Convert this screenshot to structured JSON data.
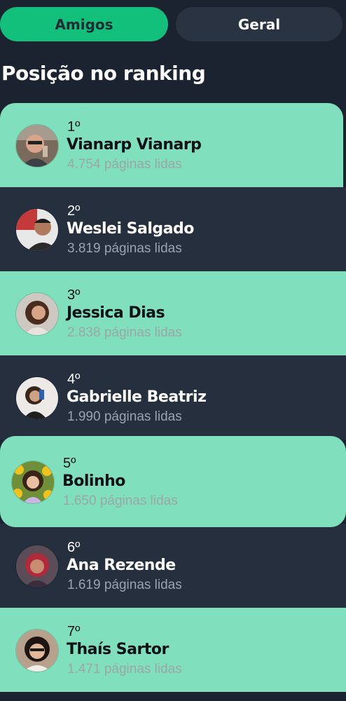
{
  "tabs": [
    {
      "label": "Amigos",
      "active": true
    },
    {
      "label": "Geral",
      "active": false
    }
  ],
  "section_title": "Posição no ranking",
  "colors": {
    "background": "#1b2230",
    "active_tab": "#12c07c",
    "inactive_tab": "#2a3341",
    "row_light": "#80dfbd",
    "row_dark": "#252f3e"
  },
  "ranking": [
    {
      "rank": "1º",
      "name": "Vianarp Vianarp",
      "pages": "4.754 páginas lidas",
      "avatar_icon": "user-photo-icon"
    },
    {
      "rank": "2º",
      "name": "Weslei Salgado",
      "pages": "3.819 páginas lidas",
      "avatar_icon": "user-photo-icon"
    },
    {
      "rank": "3º",
      "name": "Jessica Dias",
      "pages": "2.838 páginas lidas",
      "avatar_icon": "user-photo-icon"
    },
    {
      "rank": "4º",
      "name": "Gabrielle Beatriz",
      "pages": "1.990 páginas lidas",
      "avatar_icon": "user-photo-icon"
    },
    {
      "rank": "5º",
      "name": "Bolinho",
      "pages": "1.650 páginas lidas",
      "avatar_icon": "user-illustration-icon"
    },
    {
      "rank": "6º",
      "name": "Ana Rezende",
      "pages": "1.619 páginas lidas",
      "avatar_icon": "user-photo-icon"
    },
    {
      "rank": "7º",
      "name": "Thaís Sartor",
      "pages": "1.471 páginas lidas",
      "avatar_icon": "user-photo-icon"
    }
  ]
}
